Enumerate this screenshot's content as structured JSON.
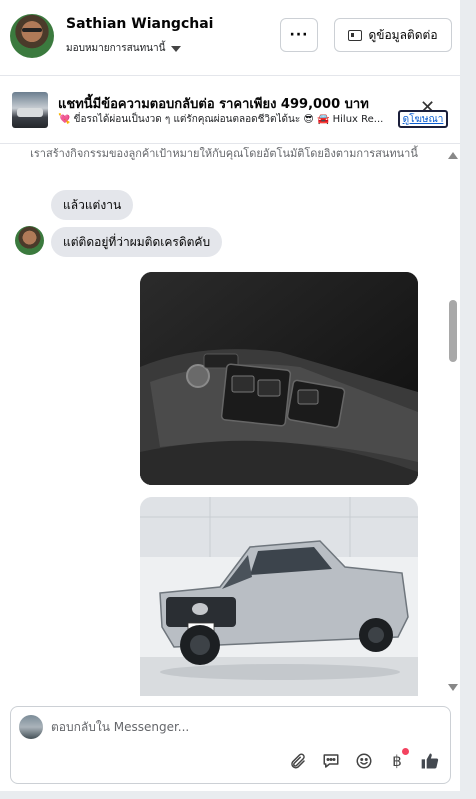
{
  "header": {
    "name": "Sathian Wiangchai",
    "assignment_label": "มอบหมายการสนทนานี้",
    "more_label": "···",
    "contact_label": "ดูข้อมูลติดต่อ"
  },
  "ad_banner": {
    "title": "แชทนี้มีข้อความตอบกลับต่อ ราคาเพียง 499,000 บาท",
    "subtitle": "💘 ขี่อรถได้ผ่อนเป็นงวด ๆ แต่รักคุณผ่อนตลอดชีวิตได้นะ 😎 🚘 Hilux Re...",
    "link_label": "ดูโฆษณา",
    "close_label": "✕"
  },
  "conversation": {
    "system_text": "เราสร้างกิจกรรมของลูกค้าเป้าหมายให้กับคุณโดยอัตโนมัติโดยอิงตามการสนทนานี้",
    "messages": [
      {
        "text": "แล้วแต่งาน"
      },
      {
        "text": "แต่ติดอยู่ที่ว่าผมติดเครดิตคับ"
      }
    ]
  },
  "composer": {
    "placeholder": "ตอบกลับใน Messenger..."
  },
  "icons": {
    "attach": "paperclip-icon",
    "saved_reply": "speech-bubble-icon",
    "emoji": "smile-icon",
    "payment": "baht-icon",
    "like": "thumbs-up-icon"
  },
  "colors": {
    "accent": "#0a5dd1",
    "bubble": "#e4e6eb",
    "notification": "#f3425f",
    "like": "#444950"
  }
}
